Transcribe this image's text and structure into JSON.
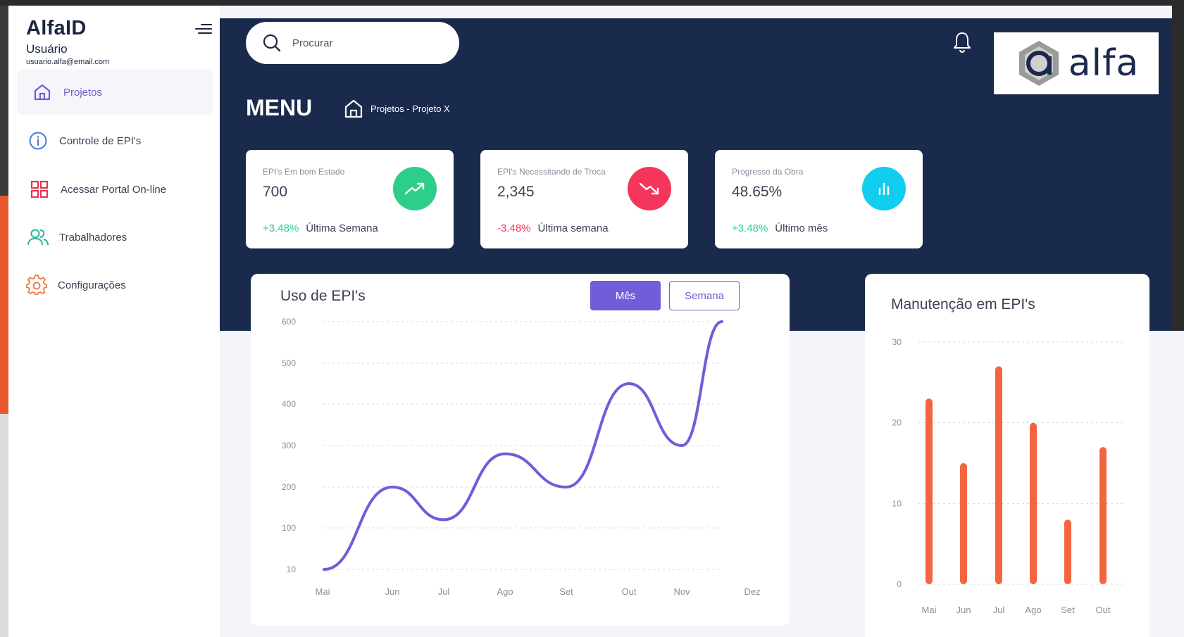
{
  "brand": {
    "title": "AlfaID",
    "user": "Usuário",
    "email": "usuario.alfa@email.com"
  },
  "sidebar": {
    "items": [
      {
        "label": "Projetos",
        "icon": "home-icon"
      },
      {
        "label": "Controle de EPI's",
        "icon": "info-icon"
      },
      {
        "label": "Acessar Portal On-line",
        "icon": "grid-icon"
      },
      {
        "label": "Trabalhadores",
        "icon": "users-icon"
      },
      {
        "label": "Configurações",
        "icon": "gear-icon"
      }
    ]
  },
  "header": {
    "search_placeholder": "Procurar",
    "menu_title": "MENU",
    "breadcrumb": "Projetos - Projeto X",
    "logo_text": "alfa"
  },
  "stats": [
    {
      "caption": "EPI's Em bom Estado",
      "value": "700",
      "change": "+3.48%",
      "period": "Última Semana",
      "color": "#2dce89"
    },
    {
      "caption": "EPI's Necessitando de Troca",
      "value": "2,345",
      "change": "-3.48%",
      "period": "Última semana",
      "color": "#f5365c"
    },
    {
      "caption": "Progresso da Obra",
      "value": "48.65%",
      "change": "+3.48%",
      "period": "Último mês",
      "color": "#11cdef"
    }
  ],
  "line_card": {
    "title": "Uso de EPI's",
    "btn_month": "Mês",
    "btn_week": "Semana"
  },
  "bar_card": {
    "title": "Manutenção em EPI's"
  },
  "chart_data": [
    {
      "type": "line",
      "title": "Uso de EPI's",
      "categories": [
        "Mai",
        "Jun",
        "Jul",
        "Ago",
        "Set",
        "Out",
        "Nov",
        "Dez"
      ],
      "series": [
        {
          "values": [
            10,
            200,
            120,
            280,
            200,
            450,
            300,
            600
          ]
        }
      ],
      "y_ticks": [
        10,
        100,
        200,
        300,
        400,
        500,
        600
      ],
      "ylim": [
        0,
        600
      ],
      "color": "#6f5dd9",
      "grid": true
    },
    {
      "type": "bar",
      "title": "Manutenção em EPI's",
      "categories": [
        "Mai",
        "Jun",
        "Jul",
        "Ago",
        "Set",
        "Out"
      ],
      "values": [
        23,
        15,
        27,
        20,
        8,
        17
      ],
      "y_ticks": [
        0,
        10,
        20,
        30
      ],
      "ylim": [
        0,
        30
      ],
      "color": "#f3653f",
      "grid": true
    }
  ]
}
